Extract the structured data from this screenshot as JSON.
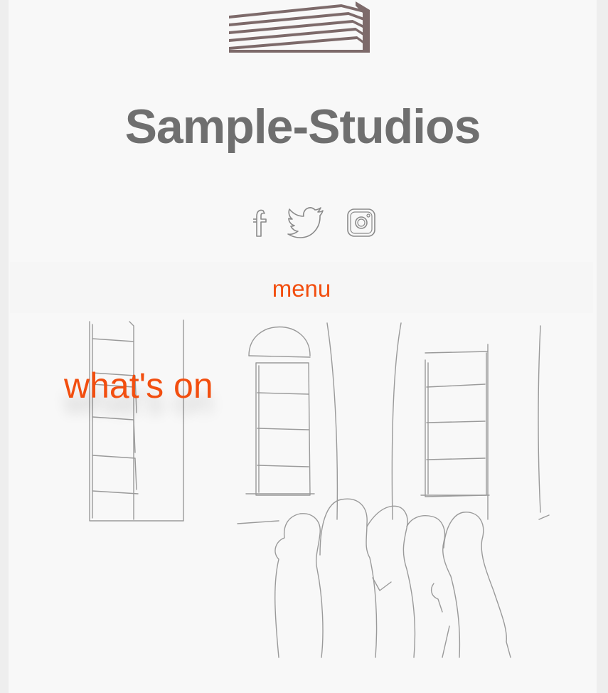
{
  "header": {
    "logo_icon": "striped-building-logo",
    "site_title": "Sample-Studios"
  },
  "social": [
    {
      "name": "facebook",
      "icon": "facebook-icon"
    },
    {
      "name": "twitter",
      "icon": "twitter-icon"
    },
    {
      "name": "instagram",
      "icon": "instagram-icon"
    }
  ],
  "nav": {
    "menu_label": "menu"
  },
  "hero": {
    "whats_on_label": "what's on",
    "illustration": "gallery-sketch-illustration"
  },
  "colors": {
    "accent": "#f24e0f",
    "title": "#6f6f6f",
    "logo": "#7d6a6a",
    "icon_stroke": "#8a8a8a",
    "background": "#f8f8f8"
  }
}
